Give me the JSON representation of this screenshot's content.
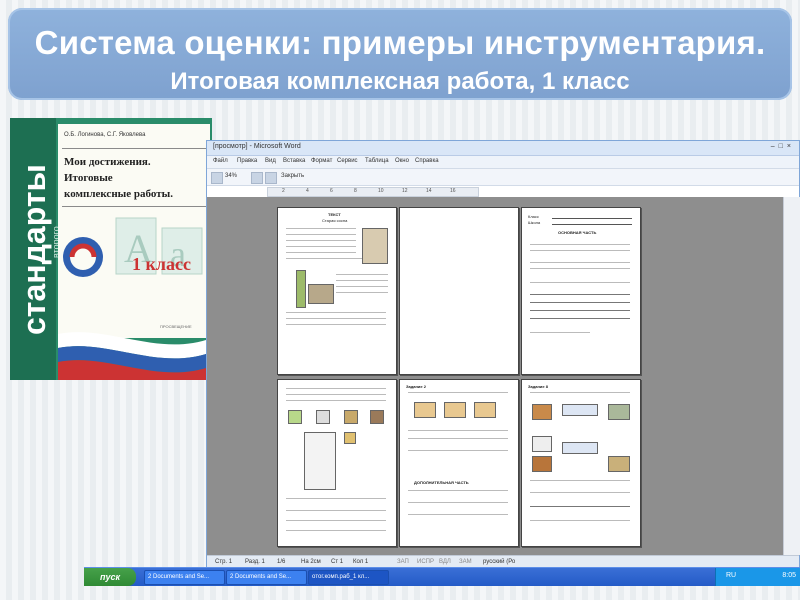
{
  "banner": {
    "title": "Система оценки: примеры инструментария.",
    "subtitle": "Итоговая комплексная работа, 1 класс"
  },
  "book": {
    "series": "стандарты",
    "series_small": "второго поколения",
    "authors": "О.Б. Логинова, С.Г. Яковлева",
    "title_line1": "Мои достижения.",
    "title_line2": "Итоговые",
    "title_line3": "комплексные работы.",
    "grade": "1 класс",
    "publisher": "ПРОСВЕЩЕНИЕ",
    "colors": {
      "green": "#2a8c6a",
      "red": "#c33",
      "blue": "#2f5fb0"
    }
  },
  "word": {
    "title": "[просмотр] - Microsoft Word",
    "menu": [
      "Файл",
      "Правка",
      "Вид",
      "Вставка",
      "Формат",
      "Сервис",
      "Таблица",
      "Окно",
      "Справка"
    ],
    "toolbar": {
      "zoom": "34%",
      "close_label": "Закрыть"
    },
    "ruler": [
      "2",
      "4",
      "6",
      "8",
      "10",
      "12",
      "14",
      "16"
    ],
    "pages": [
      {
        "heading": "ТЕКСТ",
        "subheading": "Старая сосна"
      },
      {
        "heading": ""
      },
      {
        "heading": "ОСНОВНАЯ ЧАСТЬ",
        "fields": [
          "Класс",
          "Школа",
          "Фамилия, имя"
        ]
      },
      {
        "heading": "Задание 2",
        "subheading": ""
      },
      {
        "heading": "Задание 5",
        "subheading": "ДОПОЛНИТЕЛЬНАЯ ЧАСТЬ"
      },
      {
        "heading": "Задание 8"
      }
    ],
    "status": [
      "Стр. 1",
      "Разд. 1",
      "1/6",
      "На 2см",
      "Ст 1",
      "Кол 1",
      "ЗАП",
      "ИСПР",
      "ВДЛ",
      "ЗАМ",
      "русский (Ро"
    ]
  },
  "taskbar": {
    "start": "пуск",
    "tasks": [
      "2 Documents and Se...",
      "2 Documents and Se...",
      "oтог.комп.раб_1 кл..."
    ],
    "lang": "RU",
    "time": "8:05"
  }
}
